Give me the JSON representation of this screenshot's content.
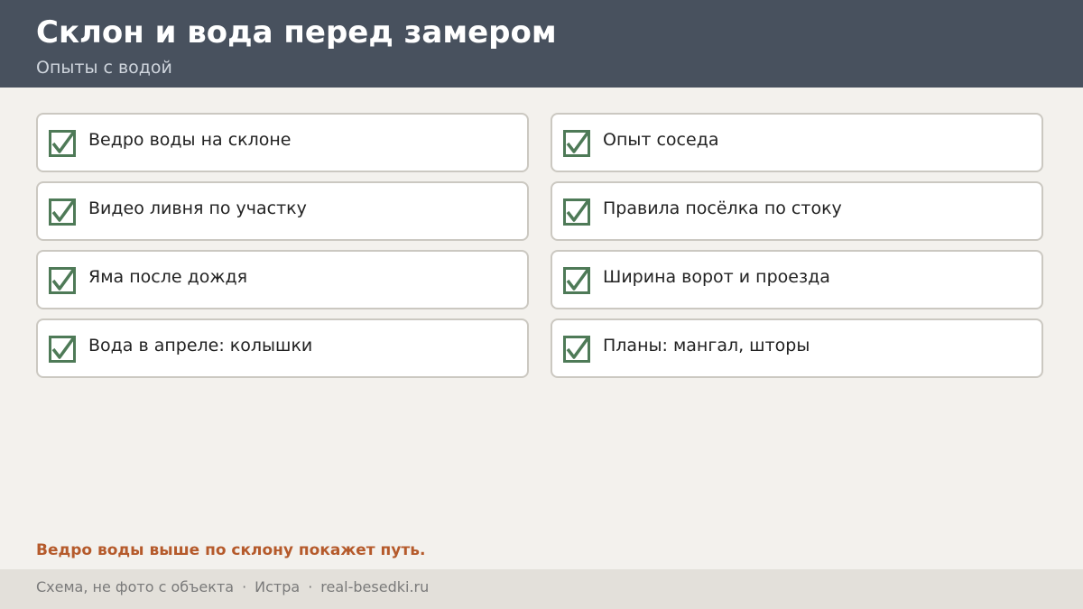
{
  "header": {
    "title": "Склон и вода перед замером",
    "subtitle": "Опыты с водой"
  },
  "checklist": {
    "check_icon": "checkmark-icon",
    "check_color": "#4e7a57",
    "items": [
      {
        "label": "Ведро воды на склоне",
        "checked": true
      },
      {
        "label": "Опыт соседа",
        "checked": true
      },
      {
        "label": "Видео ливня по участку",
        "checked": true
      },
      {
        "label": "Правила посёлка по стоку",
        "checked": true
      },
      {
        "label": "Яма после дождя",
        "checked": true
      },
      {
        "label": "Ширина ворот и проезда",
        "checked": true
      },
      {
        "label": "Вода в апреле: колышки",
        "checked": true
      },
      {
        "label": "Планы: мангал, шторы",
        "checked": true
      }
    ]
  },
  "tip": {
    "text": "Ведро воды выше по склону покажет путь.",
    "color": "#b55a2b"
  },
  "footer": {
    "note": "Схема, не фото с объекта",
    "location": "Истра",
    "site": "real-besedki.ru",
    "separator": "·"
  },
  "colors": {
    "header_bg": "#48515e",
    "page_bg": "#f3f1ed",
    "footer_bg": "#e3e0da"
  }
}
